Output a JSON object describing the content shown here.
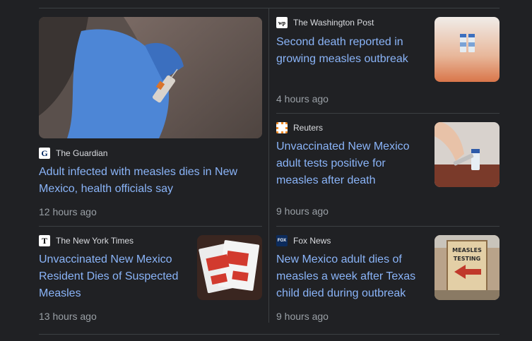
{
  "articles": [
    {
      "source": "The Guardian",
      "logo_icon": "guardian-logo-icon",
      "headline": "Adult infected with measles dies in New Mexico, health officials say",
      "time": "12 hours ago"
    },
    {
      "source": "The Washington Post",
      "logo_icon": "washington-post-logo-icon",
      "headline": "Second death reported in growing measles outbreak",
      "time": "4 hours ago"
    },
    {
      "source": "Reuters",
      "logo_icon": "reuters-logo-icon",
      "headline": "Unvaccinated New Mexico adult tests positive for measles after death",
      "time": "9 hours ago"
    },
    {
      "source": "The New York Times",
      "logo_icon": "nyt-logo-icon",
      "headline": "Unvaccinated New Mexico Resident Dies of Suspected Measles",
      "time": "13 hours ago"
    },
    {
      "source": "Fox News",
      "logo_icon": "fox-news-logo-icon",
      "headline": "New Mexico adult dies of measles a week after Texas child died during outbreak",
      "time": "9 hours ago"
    }
  ],
  "images": {
    "sign_text": "MEASLES TESTING"
  },
  "colors": {
    "background": "#202124",
    "headline": "#8ab4f8",
    "meta": "#9aa0a6",
    "divider": "#3c4043"
  }
}
